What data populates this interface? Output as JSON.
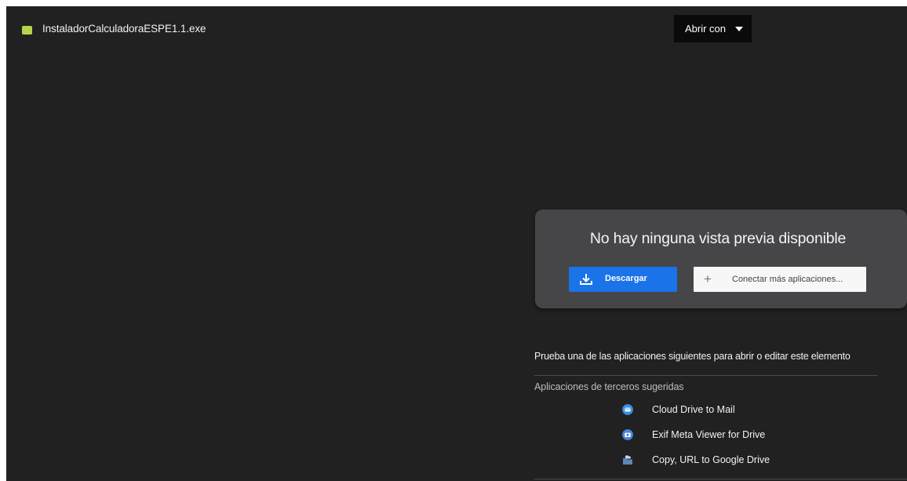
{
  "file": {
    "name": "InstaladorCalculadoraESPE1.1.exe",
    "icon": "executable-file-icon",
    "icon_color": "#b5d44a"
  },
  "toolbar": {
    "open_with_label": "Abrir con",
    "open_with_icon": "caret-down-icon"
  },
  "preview": {
    "message": "No hay ninguna vista previa disponible",
    "download_label": "Descargar",
    "download_icon": "download-icon",
    "connect_label": "Conectar más aplicaciones...",
    "connect_icon": "plus-icon"
  },
  "suggestions": {
    "prompt": "Prueba una de las aplicaciones siguientes para abrir o editar este elemento",
    "heading": "Aplicaciones de terceros sugeridas",
    "apps": [
      {
        "name": "Cloud Drive to Mail",
        "icon": "mail-icon",
        "color": "#3b8de0"
      },
      {
        "name": "Exif Meta Viewer for Drive",
        "icon": "camera-icon",
        "color": "#4a86d9"
      },
      {
        "name": "Copy, URL to Google Drive",
        "icon": "cloud-folder-icon",
        "color": "#5c86b8"
      }
    ]
  },
  "colors": {
    "background": "#212121",
    "card": "#464548",
    "accent": "#1a73e8"
  }
}
